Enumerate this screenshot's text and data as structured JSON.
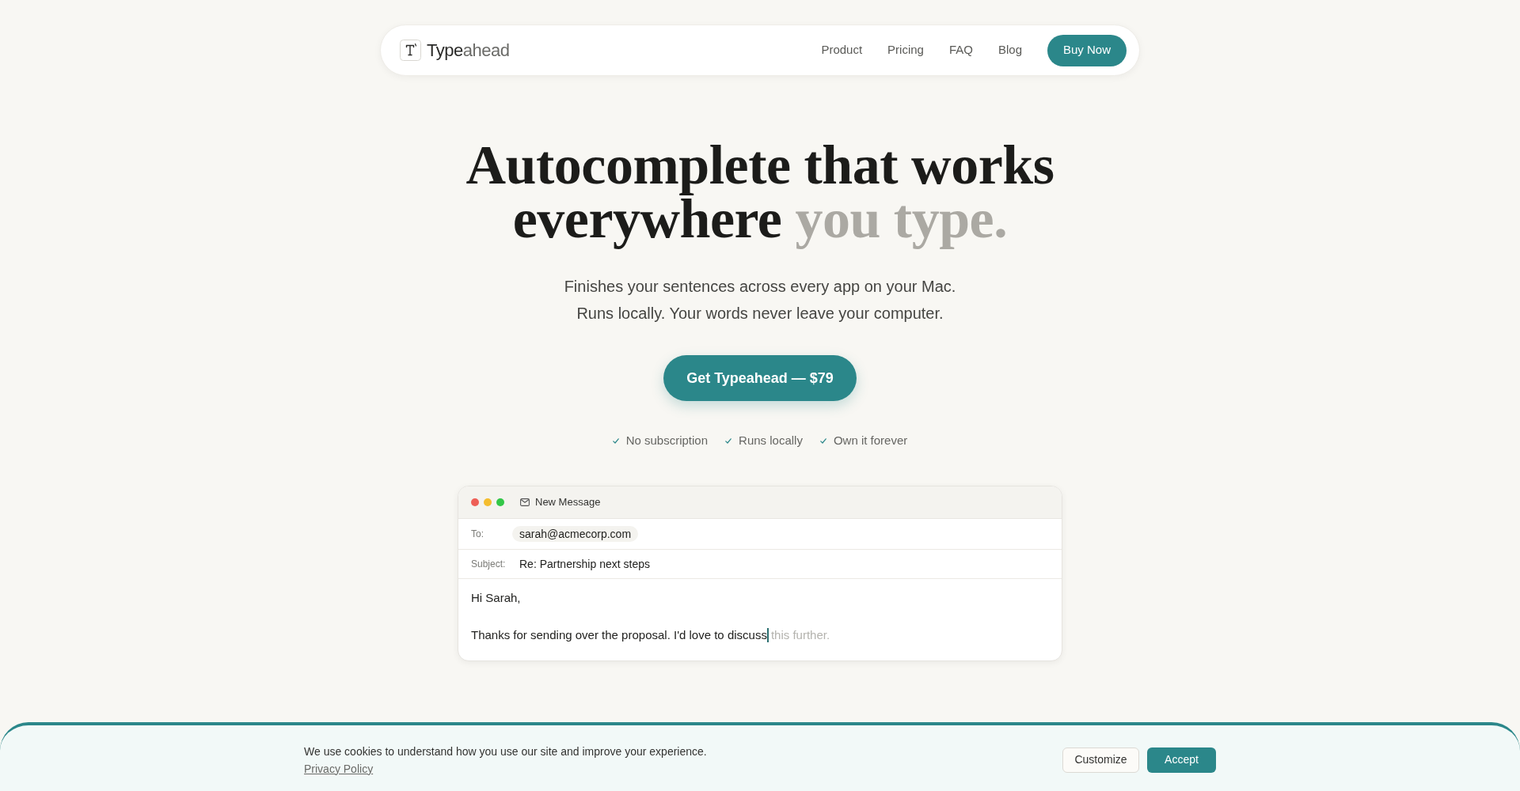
{
  "nav": {
    "logo": {
      "parts": [
        {
          "text": "Type",
          "muted": false
        },
        {
          "text": "ahead",
          "muted": true
        }
      ]
    },
    "links": [
      "Product",
      "Pricing",
      "FAQ",
      "Blog"
    ],
    "cta": "Buy Now"
  },
  "hero": {
    "headline": [
      {
        "text": "Autocomplete that works everywhere",
        "muted": false
      },
      {
        "text": "you type.",
        "muted": true
      }
    ],
    "subtitle_lines": [
      "Finishes your sentences across every app on your Mac.",
      "Runs locally. Your words never leave your computer."
    ],
    "cta": "Get Typeahead — $79",
    "highlights": [
      "No subscription",
      "Runs locally",
      "Own it forever"
    ]
  },
  "email_preview": {
    "window_title": "New Message",
    "fields": [
      {
        "label": "To:",
        "value": "sarah@acmecorp.com",
        "kind": "chip"
      },
      {
        "label": "Subject:",
        "value": "Re: Partnership next steps",
        "kind": "text"
      }
    ],
    "body": [
      {
        "text": "Hi Sarah,"
      },
      {
        "text": "Thanks for sending over the proposal. I'd love to discuss",
        "suggestion": "this further."
      }
    ]
  },
  "cookie_banner": {
    "message": "We use cookies to understand how you use our site and improve your experience.",
    "link": "Privacy Policy",
    "buttons": [
      {
        "label": "Customize",
        "kind": "secondary"
      },
      {
        "label": "Accept",
        "kind": "primary"
      }
    ]
  }
}
